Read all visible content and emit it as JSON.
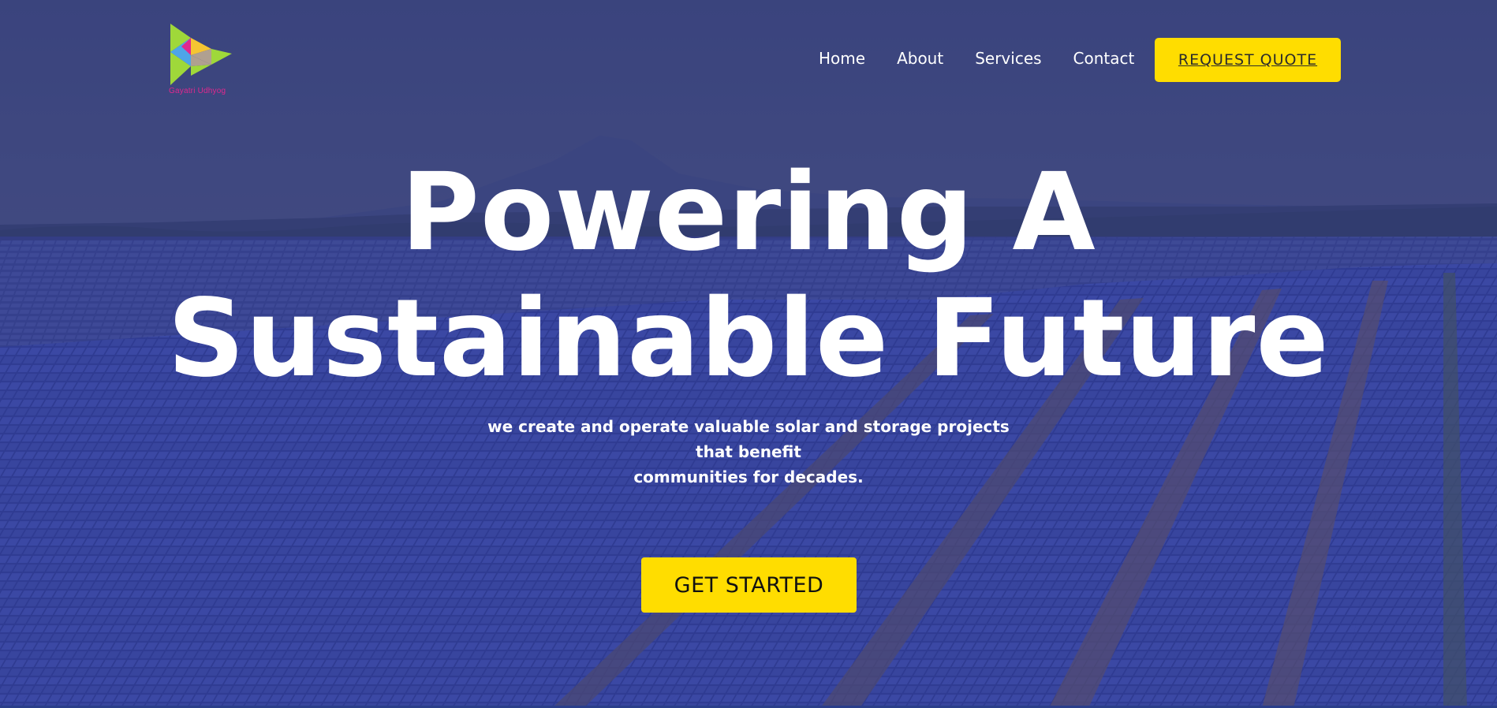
{
  "brand": {
    "logo_text": "Gayatri Udhyog",
    "icon": "triangle-play-logo-icon"
  },
  "nav": {
    "items": [
      {
        "label": "Home"
      },
      {
        "label": "About"
      },
      {
        "label": "Services"
      },
      {
        "label": "Contact"
      }
    ],
    "quote_button": "REQUEST QUOTE"
  },
  "hero": {
    "headline_line1": "Powering A",
    "headline_line2": "Sustainable Future",
    "subtitle_line1": "we create and operate valuable solar and storage projects that benefit",
    "subtitle_line2": "communities for decades.",
    "cta_button": "GET STARTED",
    "background": "solar-panel-field-image"
  },
  "colors": {
    "accent": "#ffdd00",
    "overlay": "#283078",
    "text": "#ffffff",
    "logo_magenta": "#e0288e"
  }
}
